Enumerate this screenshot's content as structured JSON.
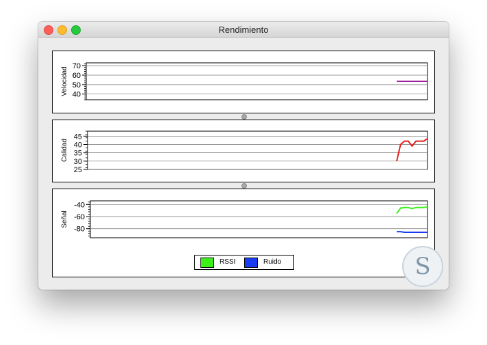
{
  "window": {
    "title": "Rendimiento",
    "controls": {
      "close_color": "#fc5f57",
      "minimize_color": "#fdbc2e",
      "maximize_color": "#28c840"
    }
  },
  "chart_data": [
    {
      "type": "line",
      "ylabel": "Velocidad",
      "yticks": [
        40,
        50,
        60,
        70
      ],
      "ylim": [
        34,
        73
      ],
      "series": [
        {
          "color": "#a020a0",
          "x": [
            0,
            1,
            2,
            3,
            4,
            5,
            6,
            7,
            8
          ],
          "values": [
            53.5,
            53.5,
            53.5,
            53.5,
            53.5,
            53.5,
            53.5,
            53.5,
            53.5
          ]
        }
      ]
    },
    {
      "type": "line",
      "ylabel": "Calidad",
      "yticks": [
        25,
        30,
        35,
        40,
        45
      ],
      "ylim": [
        25,
        48
      ],
      "series": [
        {
          "color": "#e0201b",
          "x": [
            0,
            1,
            2,
            3,
            4,
            5,
            6,
            7,
            8
          ],
          "values": [
            30,
            40,
            42,
            42,
            39,
            42,
            42,
            42,
            43.5
          ]
        }
      ]
    },
    {
      "type": "line",
      "ylabel": "Señal",
      "yticks": [
        -40,
        -60,
        -80
      ],
      "ylim": [
        -95,
        -34
      ],
      "series": [
        {
          "name": "RSSI",
          "color": "#3cf01a",
          "x": [
            0,
            1,
            2,
            3,
            4,
            5,
            6,
            7,
            8
          ],
          "values": [
            -55,
            -46,
            -45,
            -45,
            -47,
            -45,
            -45,
            -45,
            -44
          ]
        },
        {
          "name": "Ruido",
          "color": "#1a3cf0",
          "x": [
            0,
            1,
            2,
            3,
            4,
            5,
            6,
            7,
            8
          ],
          "values": [
            -85,
            -85,
            -86,
            -86,
            -86,
            -86,
            -86,
            -86,
            -86
          ]
        }
      ]
    }
  ],
  "legend": [
    {
      "label": "RSSI",
      "color": "#3cf01a"
    },
    {
      "label": "Ruido",
      "color": "#1a3cf0"
    }
  ]
}
